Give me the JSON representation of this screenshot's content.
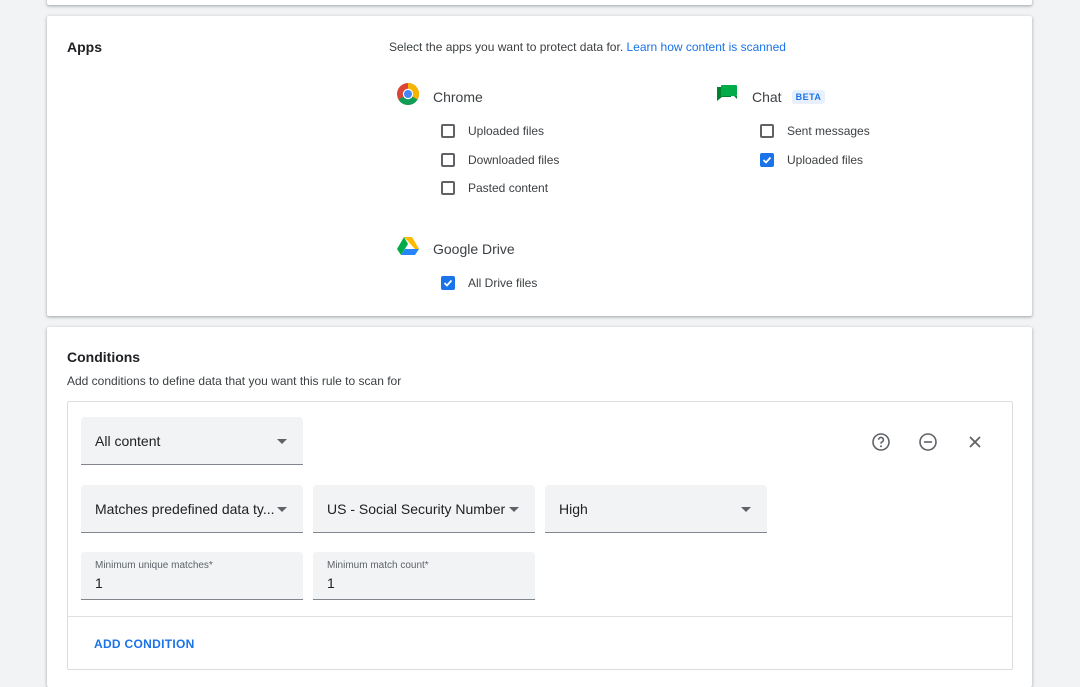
{
  "apps": {
    "title": "Apps",
    "description": "Select the apps you want to protect data for.",
    "link_text": "Learn how content is scanned",
    "chrome": {
      "label": "Chrome",
      "icon": "chrome-icon",
      "options": [
        {
          "label": "Uploaded files",
          "checked": false
        },
        {
          "label": "Downloaded files",
          "checked": false
        },
        {
          "label": "Pasted content",
          "checked": false
        }
      ]
    },
    "chat": {
      "label": "Chat",
      "badge": "BETA",
      "icon": "google-chat-icon",
      "options": [
        {
          "label": "Sent messages",
          "checked": false
        },
        {
          "label": "Uploaded files",
          "checked": true
        }
      ]
    },
    "drive": {
      "label": "Google Drive",
      "icon": "google-drive-icon",
      "options": [
        {
          "label": "All Drive files",
          "checked": true
        }
      ]
    }
  },
  "conditions": {
    "title": "Conditions",
    "description": "Add conditions to define data that you want this rule to scan for",
    "content_scope": "All content",
    "match_type": "Matches predefined data ty...",
    "data_type": "US - Social Security Number",
    "likelihood": "High",
    "min_unique_label": "Minimum unique matches*",
    "min_unique_value": "1",
    "min_count_label": "Minimum match count*",
    "min_count_value": "1",
    "add_condition": "ADD CONDITION"
  },
  "colors": {
    "accent": "#1a73e8",
    "background": "#f1f3f4",
    "field_bg": "#f1f3f4"
  }
}
